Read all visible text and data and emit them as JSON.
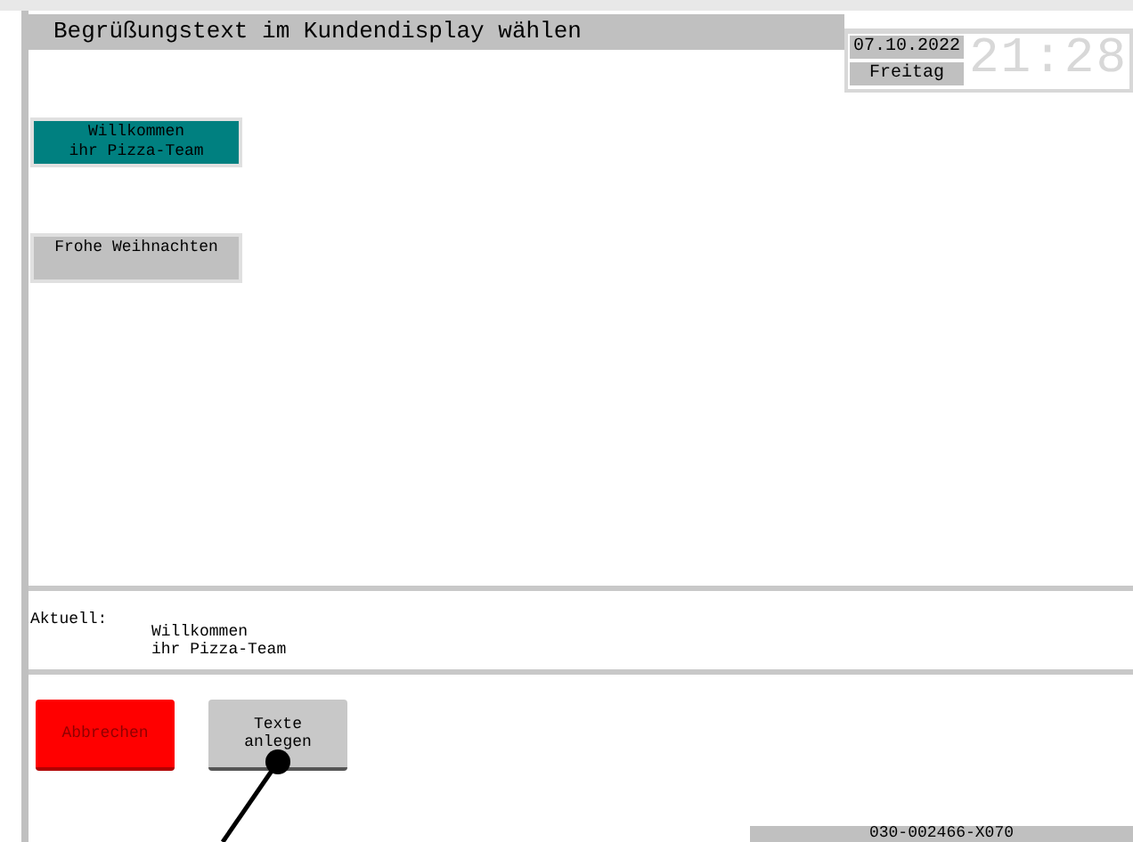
{
  "title": "Begrüßungstext im Kundendisplay wählen",
  "date": "07.10.2022",
  "weekday": "Freitag",
  "clock": "21:28",
  "texts": [
    {
      "lines": [
        "Willkommen",
        "ihr Pizza-Team"
      ],
      "selected": true
    },
    {
      "lines": [
        "Frohe Weihnachten"
      ],
      "selected": false
    }
  ],
  "current": {
    "label": "Aktuell:",
    "lines": [
      "Willkommen",
      "ihr Pizza-Team"
    ]
  },
  "buttons": [
    {
      "label": "Abbrechen",
      "kind": "danger"
    },
    {
      "label": "Texte\nanlegen",
      "kind": "normal"
    }
  ],
  "footer": "030-002466-X070"
}
